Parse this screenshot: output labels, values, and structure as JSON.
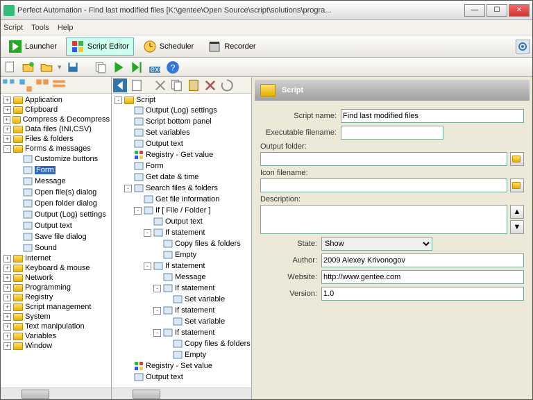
{
  "window": {
    "title": "Perfect Automation - Find last modified files [K:\\gentee\\Open Source\\script\\solutions\\progra..."
  },
  "menu": {
    "script": "Script",
    "tools": "Tools",
    "help": "Help"
  },
  "tabs": {
    "launcher": "Launcher",
    "scriptEditor": "Script Editor",
    "scheduler": "Scheduler",
    "recorder": "Recorder"
  },
  "leftTree": [
    {
      "e": "+",
      "t": "Application"
    },
    {
      "e": "+",
      "t": "Clipboard"
    },
    {
      "e": "+",
      "t": "Compress & Decompress"
    },
    {
      "e": "+",
      "t": "Data files (INI,CSV)"
    },
    {
      "e": "+",
      "t": "Files & folders"
    },
    {
      "e": "-",
      "t": "Forms & messages",
      "children": [
        {
          "t": "Customize buttons"
        },
        {
          "t": "Form",
          "sel": true
        },
        {
          "t": "Message"
        },
        {
          "t": "Open file(s) dialog"
        },
        {
          "t": "Open folder dialog"
        },
        {
          "t": "Output (Log) settings"
        },
        {
          "t": "Output text"
        },
        {
          "t": "Save file dialog"
        },
        {
          "t": "Sound"
        }
      ]
    },
    {
      "e": "+",
      "t": "Internet"
    },
    {
      "e": "+",
      "t": "Keyboard & mouse"
    },
    {
      "e": "+",
      "t": "Network"
    },
    {
      "e": "+",
      "t": "Programming"
    },
    {
      "e": "+",
      "t": "Registry"
    },
    {
      "e": "+",
      "t": "Script management"
    },
    {
      "e": "+",
      "t": "System"
    },
    {
      "e": "+",
      "t": "Text manipulation"
    },
    {
      "e": "+",
      "t": "Variables"
    },
    {
      "e": "+",
      "t": "Window"
    }
  ],
  "midTree": {
    "root": "Script",
    "items": [
      {
        "t": "Output (Log) settings"
      },
      {
        "t": "Script bottom panel"
      },
      {
        "t": "Set variables"
      },
      {
        "t": "Output text"
      },
      {
        "t": "Registry - Get value",
        "ico": "reg"
      },
      {
        "t": "Form"
      },
      {
        "t": "Get date & time"
      },
      {
        "t": "Search files & folders",
        "e": "-",
        "children": [
          {
            "t": "Get file information"
          },
          {
            "t": "If [ File / Folder ]",
            "e": "-",
            "children": [
              {
                "t": "Output text"
              },
              {
                "t": "If statement",
                "e": "-",
                "children": [
                  {
                    "t": "Copy files & folders"
                  },
                  {
                    "t": "Empty"
                  }
                ]
              },
              {
                "t": "If statement",
                "e": "-",
                "children": [
                  {
                    "t": "Message"
                  },
                  {
                    "t": "If statement",
                    "e": "-",
                    "children": [
                      {
                        "t": "Set variable"
                      }
                    ]
                  },
                  {
                    "t": "If statement",
                    "e": "-",
                    "children": [
                      {
                        "t": "Set variable"
                      }
                    ]
                  },
                  {
                    "t": "If statement",
                    "e": "-",
                    "children": [
                      {
                        "t": "Copy files & folders"
                      },
                      {
                        "t": "Empty"
                      }
                    ]
                  }
                ]
              }
            ]
          }
        ]
      },
      {
        "t": "Registry - Set value",
        "ico": "reg"
      },
      {
        "t": "Output text"
      }
    ]
  },
  "panel": {
    "title": "Script",
    "labels": {
      "scriptName": "Script name:",
      "execFile": "Executable filename:",
      "outputFolder": "Output folder:",
      "iconFile": "Icon filename:",
      "description": "Description:",
      "state": "State:",
      "author": "Author:",
      "website": "Website:",
      "version": "Version:"
    },
    "values": {
      "scriptName": "Find last modified files",
      "execFile": "",
      "outputFolder": "",
      "iconFile": "",
      "description": "",
      "state": "Show",
      "author": "2009 Alexey Krivonogov",
      "website": "http://www.gentee.com",
      "version": "1.0"
    }
  }
}
